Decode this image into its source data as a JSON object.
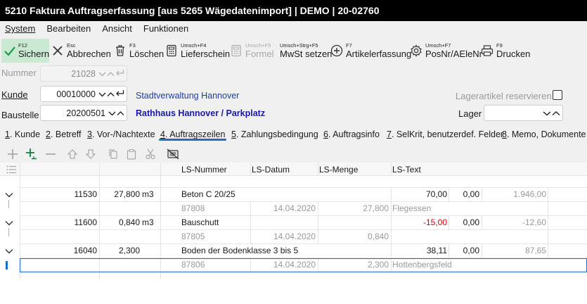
{
  "window": {
    "title": "5210 Faktura Auftragserfassung [aus 5265 Wägedatenimport] | DEMO | 20-02760"
  },
  "menu": [
    {
      "label": "System",
      "name": "menu-system"
    },
    {
      "label": "Bearbeiten",
      "name": "menu-bearbeiten"
    },
    {
      "label": "Ansicht",
      "name": "menu-ansicht"
    },
    {
      "label": "Funktionen",
      "name": "menu-funktionen"
    }
  ],
  "toolbar": {
    "sichern": {
      "key": "F12",
      "label": "Sichern",
      "icon": "check-icon"
    },
    "abbrechen": {
      "key": "Esc",
      "label": "Abbrechen",
      "icon": "close-icon"
    },
    "loeschen": {
      "key": "F3",
      "label": "Löschen",
      "icon": "trash-icon"
    },
    "lieferschein": {
      "key": "Umsch+F4",
      "label": "Lieferschein",
      "icon": "calculator-icon"
    },
    "formel": {
      "key": "Umsch+F5",
      "label": "Formel",
      "icon": "formula-icon"
    },
    "mwst": {
      "key": "Umsch+Strg+F5",
      "label": "MwSt setzen",
      "icon": ""
    },
    "artikelerfassung": {
      "key": "F7",
      "label": "Artikelerfassung",
      "icon": "plus-circle-icon"
    },
    "posnr": {
      "key": "Umsch+F7",
      "label": "PosNr/AEleNr",
      "icon": "gear-icon"
    },
    "drucken": {
      "key": "F9",
      "label": "Drucken",
      "icon": "printer-icon"
    }
  },
  "form": {
    "nummer": {
      "label": "Nummer",
      "value": "21028"
    },
    "kunde": {
      "label": "Kunde",
      "value": "00010000",
      "name": "Stadtverwaltung Hannover"
    },
    "baustelle": {
      "label": "Baustelle",
      "value": "20200501",
      "name": "Rathhaus Hannover / Parkplatz"
    },
    "lagerartikel": {
      "label": "Lagerartikel reservieren",
      "checked": false
    },
    "lager": {
      "label": "Lager",
      "value": ""
    }
  },
  "tabs": [
    {
      "key": "1",
      "rest": ". Kunde"
    },
    {
      "key": "2",
      "rest": ". Betreff"
    },
    {
      "key": "3",
      "rest": ". Vor-/Nachtexte"
    },
    {
      "key": "4",
      "rest": ". Auftragszeilen"
    },
    {
      "key": "5",
      "rest": ". Zahlungsbedingung"
    },
    {
      "key": "6",
      "rest": ". Auftragsinfo"
    },
    {
      "key": "7",
      "rest": ". SelKrit, benutzerdef. Felder"
    },
    {
      "key": "8",
      "rest": ". Memo, Dokumente"
    }
  ],
  "grid": {
    "headers": {
      "ls_nummer": "LS-Nummer",
      "ls_datum": "LS-Datum",
      "ls_menge": "LS-Menge",
      "ls_text": "LS-Text"
    },
    "positions": [
      {
        "artikel": "11530",
        "menge": "27,800",
        "einheit": "m3",
        "bezeichnung": "Beton C 20/25",
        "preis": "70,00",
        "rabatt": "0,00",
        "gesamt": "1.946,00",
        "sub": {
          "ls_nummer": "87808",
          "ls_datum": "14.04.2020",
          "ls_menge": "27,800",
          "ls_text": "Flegessen"
        }
      },
      {
        "artikel": "11600",
        "menge": "0,840",
        "einheit": "m3",
        "bezeichnung": "Bauschutt",
        "preis": "-15,00",
        "rabatt": "0,00",
        "gesamt": "-12,60",
        "sub": {
          "ls_nummer": "87805",
          "ls_datum": "14.04.2020",
          "ls_menge": "0,840",
          "ls_text": ""
        }
      },
      {
        "artikel": "16040",
        "menge": "2,300",
        "einheit": "",
        "bezeichnung": "Boden der Bodenklasse 3 bis 5",
        "preis": "38,11",
        "rabatt": "0,00",
        "gesamt": "87,65",
        "sub": {
          "ls_nummer": "87806",
          "ls_datum": "14.04.2020",
          "ls_menge": "2,300",
          "ls_text": "Hottenbergsfeld"
        }
      }
    ]
  },
  "colors": {
    "accent": "#1b6fc8",
    "save_highlight": "#c9e9d3",
    "negative": "#e00000",
    "link": "#1f3cb0"
  }
}
